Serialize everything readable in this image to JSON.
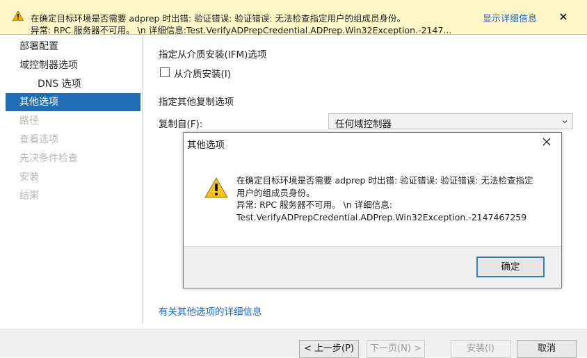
{
  "banner": {
    "line1": "在确定目标环境是否需要 adprep 时出错: 验证错误: 验证错误: 无法检查指定用户的组成员身份。",
    "line2": "异常: RPC 服务器不可用。 \\n 详细信息:Test.VerifyADPrepCredential.ADPrep.Win32Exception.-2147...",
    "details_link": "显示详细信息",
    "close": "×"
  },
  "nav": {
    "items": [
      {
        "label": "部署配置"
      },
      {
        "label": "域控制器选项"
      },
      {
        "label": "DNS 选项"
      },
      {
        "label": "其他选项"
      },
      {
        "label": "路径"
      },
      {
        "label": "查看选项"
      },
      {
        "label": "先决条件检查"
      },
      {
        "label": "安装"
      },
      {
        "label": "结果"
      }
    ]
  },
  "main": {
    "ifm_heading": "指定从介质安装(IFM)选项",
    "ifm_checkbox_label": "从介质安装(I)",
    "replication_heading": "指定其他复制选项",
    "replicate_from_label": "复制自(F):",
    "replicate_from_value": "任何域控制器",
    "more_info_link": "有关其他选项的详细信息"
  },
  "dialog": {
    "title": "其他选项",
    "message_lines": [
      "在确定目标环境是否需要 adprep 时出错: 验证错误: 验证错误: 无法检查指定",
      "用户的组成员身份。",
      "异常: RPC 服务器不可用。 \\n 详细信息:",
      "Test.VerifyADPrepCredential.ADPrep.Win32Exception.-2147467259"
    ],
    "ok": "确定"
  },
  "buttons": {
    "back": "< 上一步(P)",
    "next": "下一页(N) >",
    "install": "安装(I)",
    "cancel": "取消"
  },
  "colors": {
    "banner_bg": "#fff6c8",
    "accent": "#1f6db5",
    "link": "#1d63c6"
  }
}
